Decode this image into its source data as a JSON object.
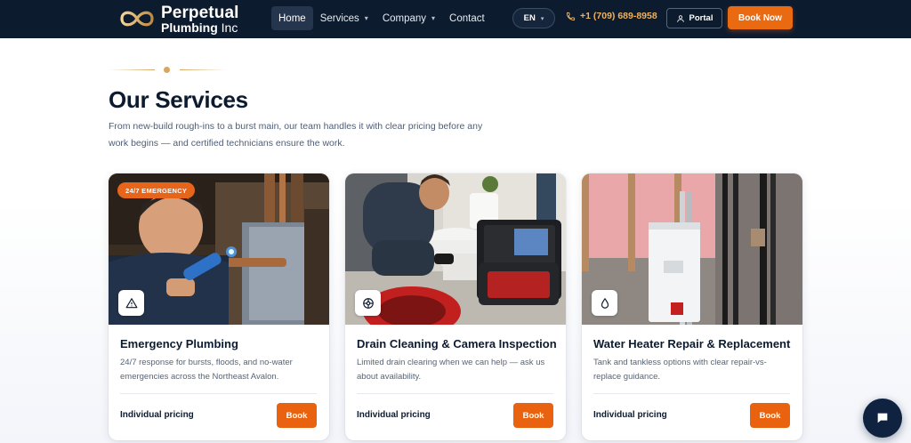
{
  "nav": {
    "logo": {
      "line1": "Perpetual",
      "line2": "Plumbing",
      "line2_suffix": "Inc"
    },
    "menu": [
      {
        "label": "Home",
        "active": true,
        "dropdown": false
      },
      {
        "label": "Services",
        "active": false,
        "dropdown": true
      },
      {
        "label": "Company",
        "active": false,
        "dropdown": true
      },
      {
        "label": "Contact",
        "active": false,
        "dropdown": false
      }
    ],
    "language": "EN",
    "phone": "+1 (709) 689-8958",
    "portal": "Portal",
    "book_now": "Book Now"
  },
  "section": {
    "title": "Our Services",
    "subtitle": "From new-build rough-ins to a burst main, our team handles it with clear pricing before any work begins — and certified technicians ensure the work."
  },
  "cards": [
    {
      "badge": "24/7 EMERGENCY",
      "icon": "warning-triangle-icon",
      "title": "Emergency Plumbing",
      "description": "24/7 response for bursts, floods, and no-water emergencies across the Northeast Avalon.",
      "price": "Individual pricing",
      "button": "Book"
    },
    {
      "badge": "",
      "icon": "drain-icon",
      "title": "Drain Cleaning & Camera Inspection",
      "description": "Limited drain clearing when we can help — ask us about availability.",
      "price": "Individual pricing",
      "button": "Book"
    },
    {
      "badge": "",
      "icon": "water-drop-icon",
      "title": "Water Heater Repair & Replacement",
      "description": "Tank and tankless options with clear repair-vs-replace guidance.",
      "price": "Individual pricing",
      "button": "Book"
    }
  ],
  "colors": {
    "nav_bg": "#0d1b2e",
    "accent_orange": "#e8620f",
    "phone_gold": "#f0b15b",
    "title_navy": "#0d1b2e"
  }
}
